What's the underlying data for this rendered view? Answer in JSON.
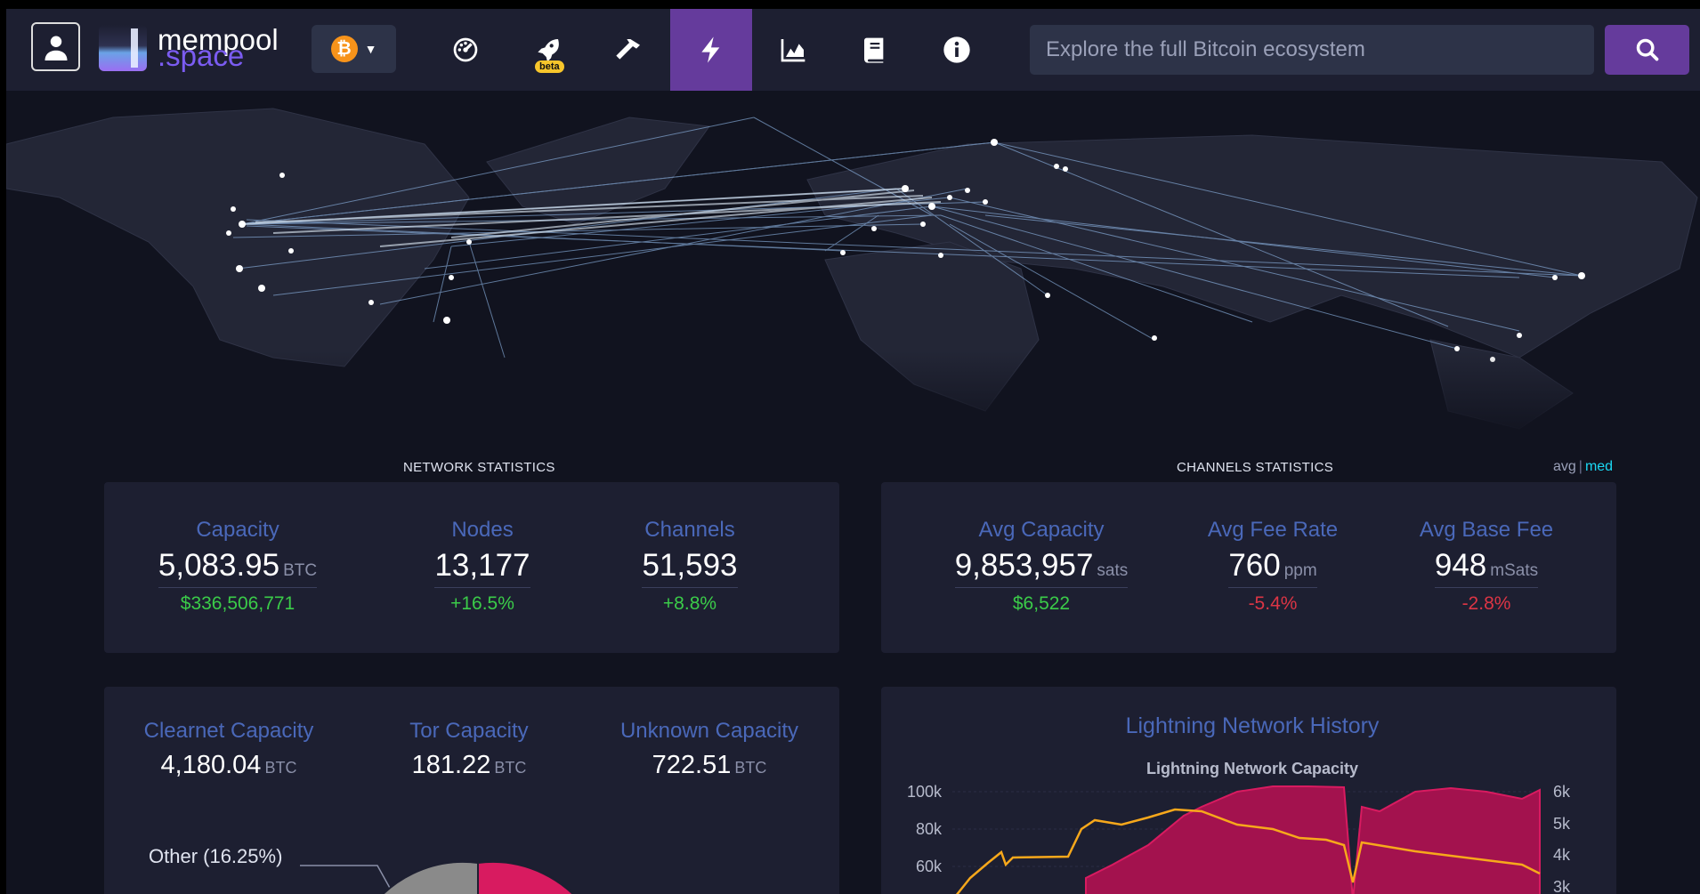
{
  "logo": {
    "line1": "mempool",
    "line2": ".space"
  },
  "nav": {
    "network_symbol": "₿",
    "icons": [
      "dashboard-icon",
      "rocket-icon",
      "hammer-icon",
      "lightning-icon",
      "chart-icon",
      "book-icon",
      "info-icon"
    ],
    "beta_badge": "beta",
    "active_icon": "lightning-icon"
  },
  "search": {
    "placeholder": "Explore the full Bitcoin ecosystem"
  },
  "network_statistics": {
    "title": "NETWORK STATISTICS",
    "capacity": {
      "label": "Capacity",
      "value": "5,083.95",
      "unit": "BTC",
      "sub": "$336,506,771"
    },
    "nodes": {
      "label": "Nodes",
      "value": "13,177",
      "sub": "+16.5%"
    },
    "channels": {
      "label": "Channels",
      "value": "51,593",
      "sub": "+8.8%"
    }
  },
  "channels_statistics": {
    "title": "CHANNELS STATISTICS",
    "toggle": {
      "avg": "avg",
      "sep": "|",
      "med": "med"
    },
    "avg_capacity": {
      "label": "Avg Capacity",
      "value": "9,853,957",
      "unit": "sats",
      "sub": "$6,522"
    },
    "avg_fee_rate": {
      "label": "Avg Fee Rate",
      "value": "760",
      "unit": "ppm",
      "sub": "-5.4%"
    },
    "avg_base_fee": {
      "label": "Avg Base Fee",
      "value": "948",
      "unit": "mSats",
      "sub": "-2.8%"
    }
  },
  "capacity_breakdown": {
    "clearnet": {
      "label": "Clearnet Capacity",
      "value": "4,180.04",
      "unit": "BTC"
    },
    "tor": {
      "label": "Tor Capacity",
      "value": "181.22",
      "unit": "BTC"
    },
    "unknown": {
      "label": "Unknown Capacity",
      "value": "722.51",
      "unit": "BTC"
    },
    "pie_label": "Other (16.25%)"
  },
  "history": {
    "title": "Lightning Network History",
    "chart_title": "Lightning Network Capacity",
    "left_ticks": [
      "100k",
      "80k",
      "60k"
    ],
    "right_ticks": [
      "6k",
      "5k",
      "4k",
      "3k"
    ]
  },
  "colors": {
    "accent": "#653b9c",
    "label_blue": "#4a68b9",
    "green": "#3bcc49",
    "red": "#dc3545",
    "capacity_line": "#f7a81b",
    "channels_area": "#c2185b"
  },
  "chart_data": {
    "type": "line",
    "title": "Lightning Network Capacity",
    "series": [],
    "y_left_ticks": [
      "100k",
      "80k",
      "60k"
    ],
    "y_right_ticks": [
      "6k",
      "5k",
      "4k",
      "3k"
    ]
  }
}
